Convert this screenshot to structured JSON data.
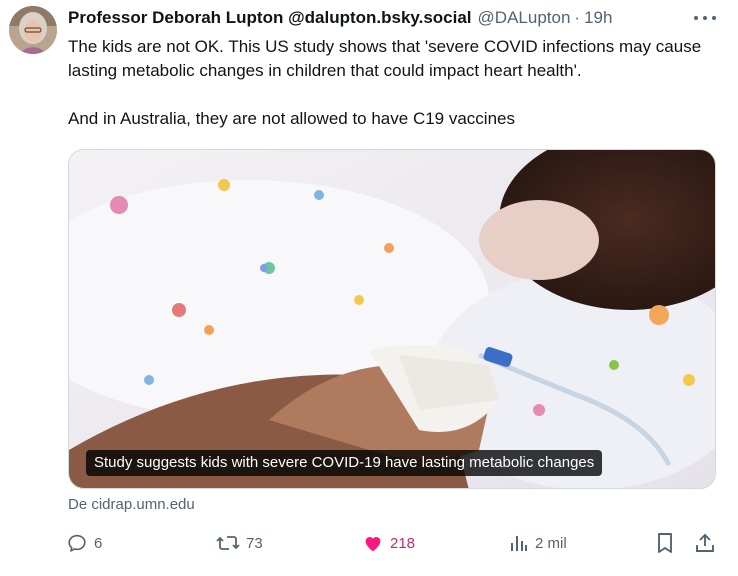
{
  "author": {
    "display_name": "Professor Deborah Lupton @dalupton.bsky.social",
    "handle": "@DALupton",
    "separator": "·",
    "time": "19h"
  },
  "tweet": {
    "paragraphs": [
      "The kids are not OK. This US study shows that 'severe COVID infections may cause lasting metabolic changes in children that could impact heart health'.",
      "And in Australia, they are not allowed to have C19 vaccines"
    ]
  },
  "media": {
    "caption": "Study suggests kids with severe COVID-19 have lasting metabolic changes"
  },
  "source": "De cidrap.umn.edu",
  "actions": {
    "replies": "6",
    "reposts": "73",
    "likes": "218",
    "views": "2 mil"
  },
  "icons": {
    "reply": "reply-icon",
    "repost": "repost-icon",
    "like": "heart-icon",
    "views": "views-icon",
    "bookmark": "bookmark-icon",
    "share": "share-icon",
    "more": "more-icon"
  },
  "colors": {
    "text": "#0f1419",
    "secondary": "#536471",
    "like_active": "#f91880",
    "like_count": "#c9286d"
  }
}
